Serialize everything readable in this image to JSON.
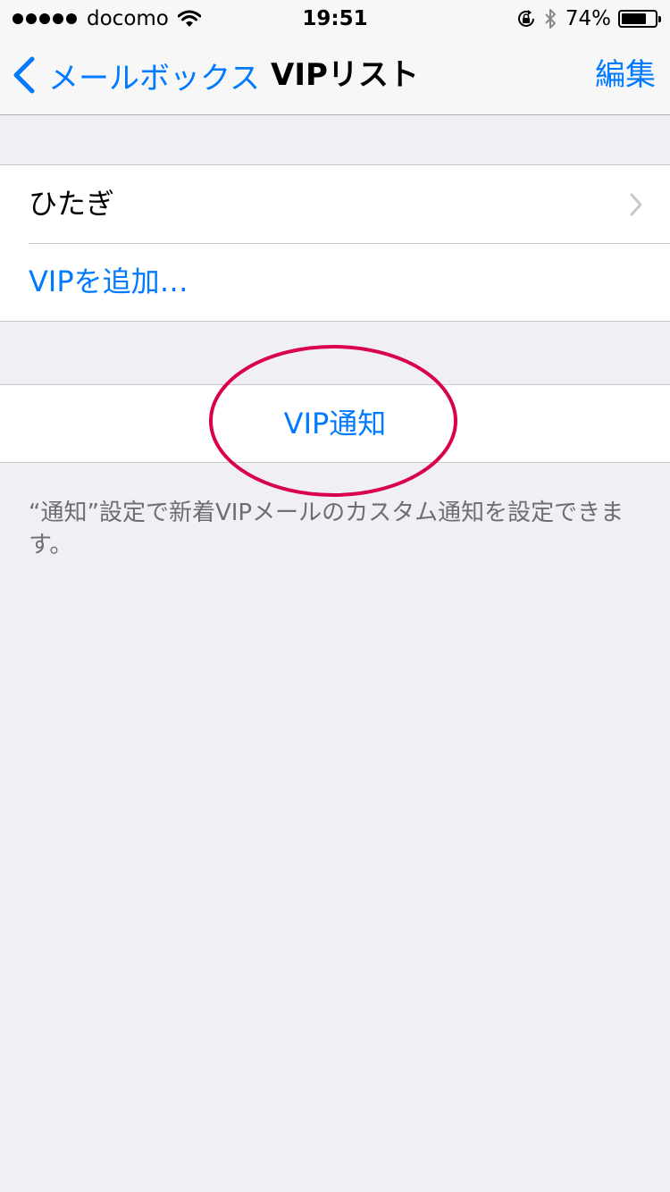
{
  "status_bar": {
    "carrier": "docomo",
    "time": "19:51",
    "battery_percent_label": "74%",
    "battery_level": 0.74,
    "icons": [
      "signal-dots-icon",
      "wifi-icon",
      "rotation-lock-icon",
      "bluetooth-icon",
      "battery-icon"
    ]
  },
  "nav": {
    "back_label": "メールボックス",
    "title": "VIPリスト",
    "edit_label": "編集"
  },
  "vip_list": {
    "contacts": [
      {
        "name": "ひたぎ"
      }
    ],
    "add_label": "VIPを追加…"
  },
  "notifications": {
    "button_label": "VIP通知",
    "highlight_color": "#d9004c"
  },
  "footer": {
    "note": "“通知”設定で新着VIPメールのカスタム通知を設定できます。"
  },
  "colors": {
    "accent": "#007aff",
    "background": "#efeff4",
    "secondary_text": "#6d6d72"
  }
}
